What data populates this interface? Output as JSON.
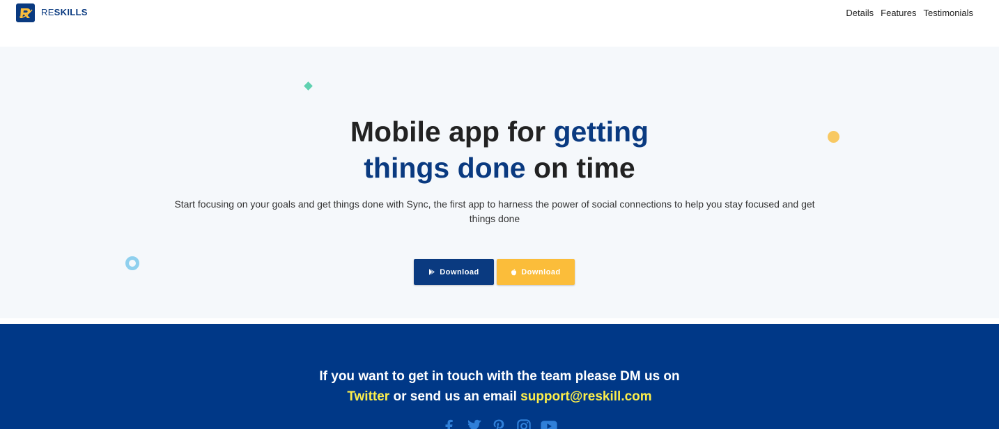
{
  "navbar": {
    "brand_prefix": "RE",
    "brand_suffix": "SKILLS",
    "links": [
      {
        "label": "Details"
      },
      {
        "label": "Features"
      },
      {
        "label": "Testimonials"
      }
    ]
  },
  "hero": {
    "headline_part1": "Mobile app for ",
    "headline_accent1": "getting",
    "headline_accent2": "things done",
    "headline_part2": " on time",
    "subtext": "Start focusing on your goals and get things done with Sync, the first app to harness the power of social connections to help you stay focused and get things done",
    "buttons": [
      {
        "label": "Download",
        "icon": "play-store-icon"
      },
      {
        "label": "Download",
        "icon": "apple-icon"
      }
    ]
  },
  "footer": {
    "line1": "If you want to get in touch with the team please DM us on",
    "twitter_label": "Twitter",
    "middle": " or send us an email ",
    "email": "support@reskill.com",
    "socials": [
      "facebook-icon",
      "twitter-icon",
      "pinterest-icon",
      "instagram-icon",
      "youtube-icon"
    ]
  },
  "colors": {
    "brand_blue": "#0a3a80",
    "footer_blue": "#003887",
    "yellow": "#fbbd3a",
    "highlight": "#fcee4b",
    "hero_bg": "#f5f8fb"
  }
}
